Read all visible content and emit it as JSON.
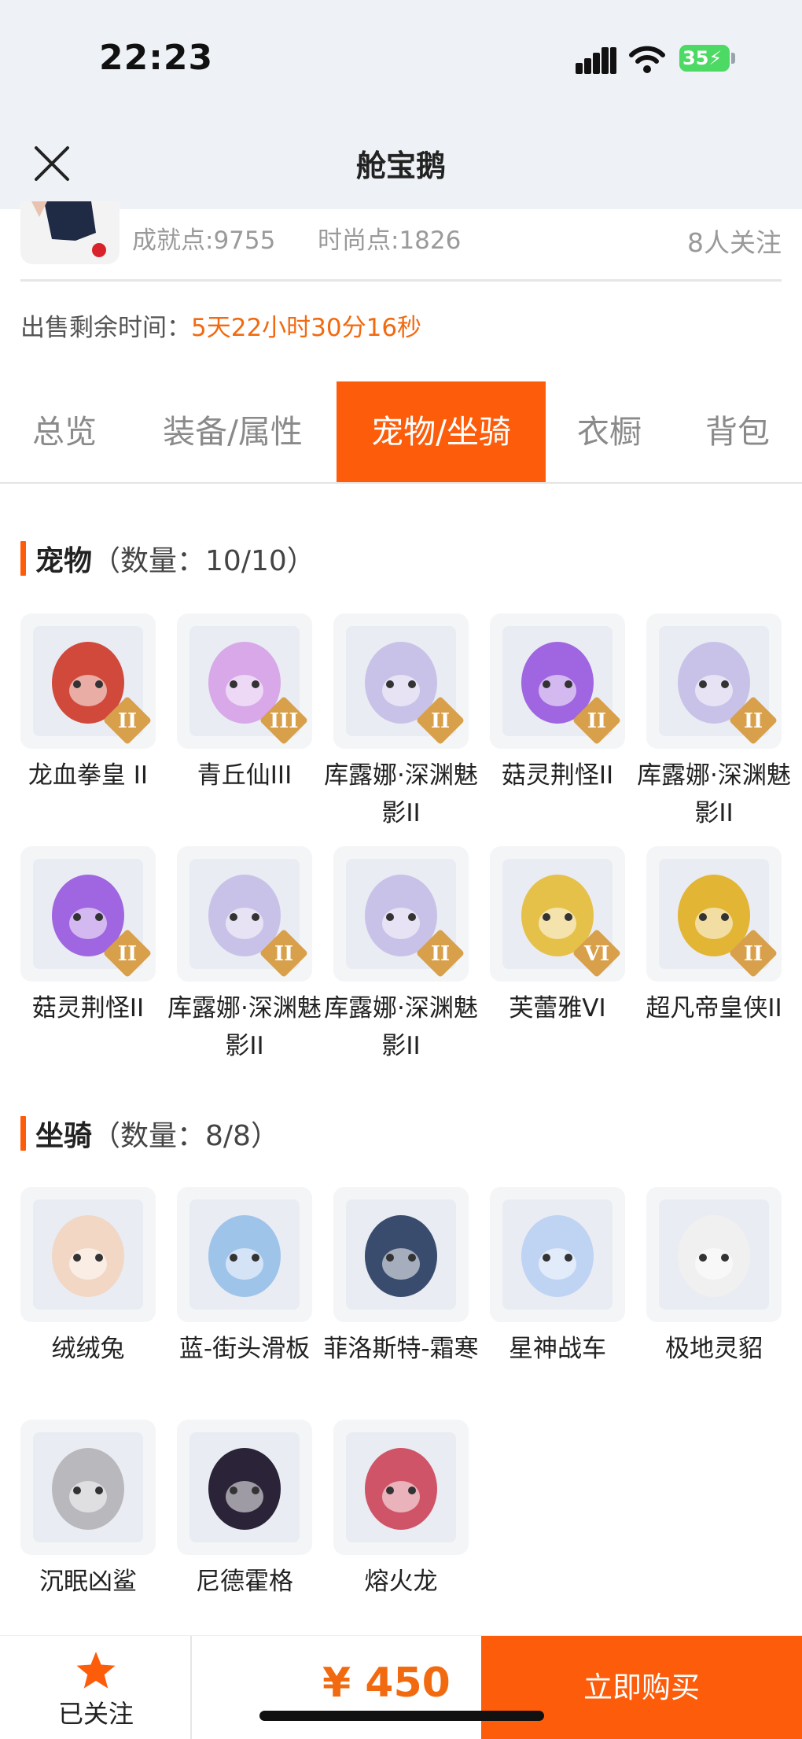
{
  "status_bar": {
    "time": "22:23",
    "battery": "35"
  },
  "nav": {
    "title": "舱宝鹅"
  },
  "profile": {
    "achievement": "成就点:9755",
    "fashion": "时尚点:1826",
    "followers": "8人关注"
  },
  "sale": {
    "label": "出售剩余时间：",
    "remaining": "5天22小时30分16秒"
  },
  "tabs": [
    "总览",
    "装备/属性",
    "宠物/坐骑",
    "衣橱",
    "背包"
  ],
  "active_tab": "宠物/坐骑",
  "pets": {
    "title": "宠物",
    "count": "（数量：10/10）",
    "items": [
      {
        "name": "龙血拳皇 II",
        "rank": "II",
        "color": "#d0493a"
      },
      {
        "name": "青丘仙III",
        "rank": "III",
        "color": "#d8a8e8"
      },
      {
        "name": "库露娜·深渊魅影II",
        "rank": "II",
        "color": "#c9c2e8"
      },
      {
        "name": "菇灵荆怪II",
        "rank": "II",
        "color": "#a065e0"
      },
      {
        "name": "库露娜·深渊魅影II",
        "rank": "II",
        "color": "#c9c2e8"
      },
      {
        "name": "菇灵荆怪II",
        "rank": "II",
        "color": "#a065e0"
      },
      {
        "name": "库露娜·深渊魅影II",
        "rank": "II",
        "color": "#c9c2e8"
      },
      {
        "name": "库露娜·深渊魅影II",
        "rank": "II",
        "color": "#c9c2e8"
      },
      {
        "name": "芙蕾雅VI",
        "rank": "VI",
        "color": "#e6c14a"
      },
      {
        "name": "超凡帝皇侠II",
        "rank": "II",
        "color": "#e3b534"
      }
    ]
  },
  "mounts": {
    "title": "坐骑",
    "count": "（数量：8/8）",
    "items": [
      {
        "name": "绒绒兔",
        "color": "#f1d7c4"
      },
      {
        "name": "蓝-街头滑板",
        "color": "#9fc4ea"
      },
      {
        "name": "菲洛斯特-霜寒",
        "color": "#3a4c6e"
      },
      {
        "name": "星神战车",
        "color": "#bfd3f2"
      },
      {
        "name": "极地灵貂",
        "color": "#f0f0f0"
      },
      {
        "name": "沉眠凶鲨",
        "color": "#b9b9bd"
      },
      {
        "name": "尼德霍格",
        "color": "#2b2338"
      },
      {
        "name": "熔火龙",
        "color": "#d05467"
      }
    ]
  },
  "bottom": {
    "follow_label": "已关注",
    "price": "¥ 450",
    "buy_label": "立即购买"
  },
  "colors": {
    "accent": "#fd5c0a",
    "highlight_text": "#f26a10"
  }
}
